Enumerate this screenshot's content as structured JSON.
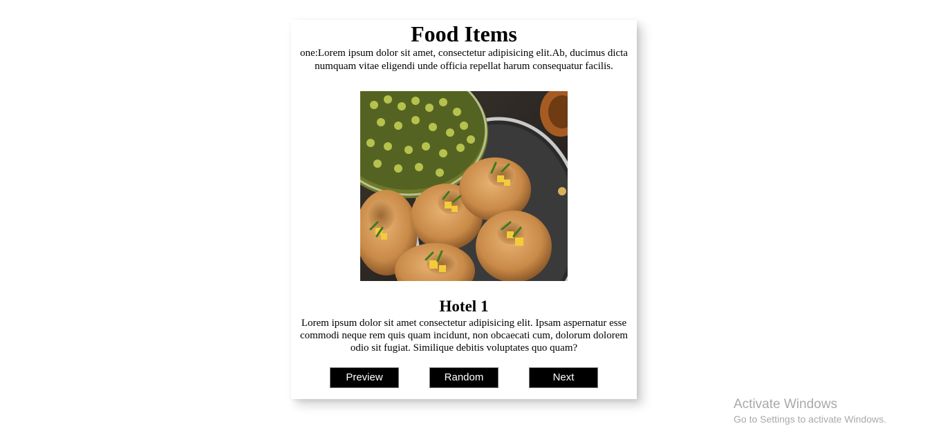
{
  "header": {
    "title": "Food Items",
    "intro": "one:Lorem ipsum dolor sit amet, consectetur adipisicing elit.Ab, ducimus dicta numquam vitae eligendi unde officia repellat harum consequatur facilis."
  },
  "item": {
    "image_icon": "food-photo-pani-puri",
    "name": "Hotel 1",
    "description": "Lorem ipsum dolor sit amet consectetur adipisicing elit. Ipsam aspernatur esse commodi neque rem quis quam incidunt, non obcaecati cum, dolorum dolorem odio sit fugiat. Similique debitis voluptates quo quam?"
  },
  "buttons": {
    "preview": "Preview",
    "random": "Random",
    "next": "Next"
  },
  "watermark": {
    "title": "Activate Windows",
    "subtitle": "Go to Settings to activate Windows."
  },
  "colors": {
    "button_bg": "#000000",
    "button_text": "#ffffff",
    "watermark_text": "#a9a9a9"
  }
}
